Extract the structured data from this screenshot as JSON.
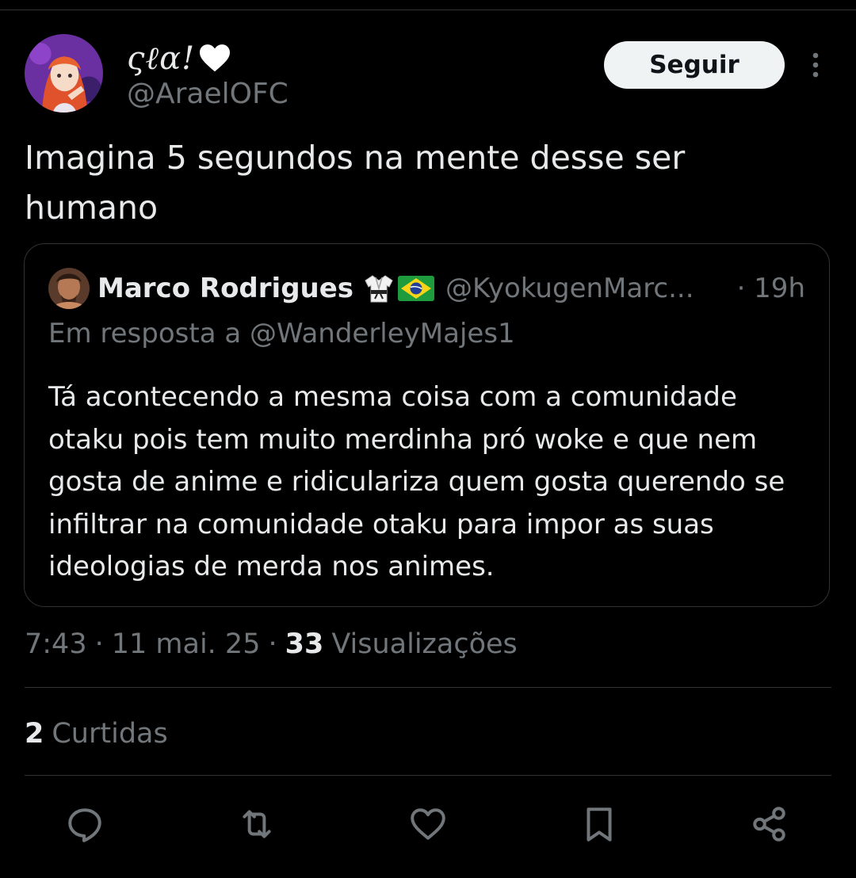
{
  "author": {
    "display_name": "ςℓα!",
    "handle": "@AraelOFC",
    "avatar_icon": "anime-avatar-icon",
    "name_emoji_icon": "white-heart-icon"
  },
  "follow_button": {
    "label": "Seguir"
  },
  "more_menu": {
    "icon": "more-vertical-icon"
  },
  "tweet": {
    "text": "Imagina 5 segundos na mente desse ser humano"
  },
  "quote": {
    "name": "Marco Rodrigues",
    "emoji_icons": [
      "martial-arts-uniform-icon",
      "brazil-flag-icon"
    ],
    "handle": "@KyokugenMarc...",
    "time": "· 19h",
    "reply_prefix": "Em resposta a ",
    "reply_handle": "@WanderleyMajes1",
    "text": "Tá acontecendo a mesma coisa com a comunidade otaku pois tem muito merdinha pró woke e que nem gosta de anime e ridiculariza quem gosta querendo se infiltrar na comunidade otaku para impor as suas ideologias de merda nos animes."
  },
  "meta": {
    "time": "7:43",
    "sep1": "·",
    "date": "11 mai. 25",
    "sep2": "·",
    "views_count": "33",
    "views_label": "Visualizações"
  },
  "likes": {
    "count": "2",
    "label": "Curtidas"
  },
  "actions": [
    {
      "name": "reply",
      "icon": "reply-icon"
    },
    {
      "name": "retweet",
      "icon": "retweet-icon"
    },
    {
      "name": "like",
      "icon": "heart-icon"
    },
    {
      "name": "bookmark",
      "icon": "bookmark-icon"
    },
    {
      "name": "share",
      "icon": "share-icon"
    }
  ],
  "colors": {
    "background": "#000000",
    "text_primary": "#e7e9ea",
    "text_secondary": "#71767b",
    "border": "#2f3336",
    "button_bg": "#eff3f4",
    "button_text": "#0f1419"
  }
}
